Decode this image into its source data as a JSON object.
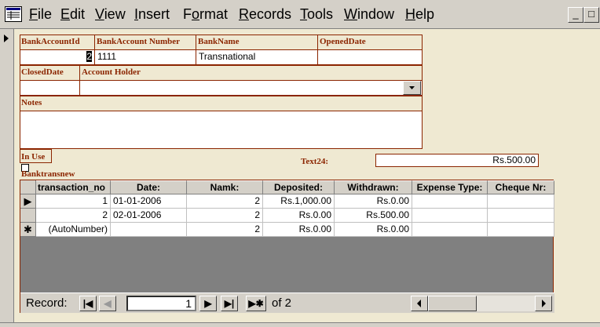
{
  "menu": {
    "items": [
      {
        "label": "File",
        "u": "F",
        "rest": "ile"
      },
      {
        "label": "Edit",
        "u": "E",
        "rest": "dit"
      },
      {
        "label": "View",
        "u": "V",
        "rest": "iew"
      },
      {
        "label": "Insert",
        "u": "I",
        "rest": "nsert"
      },
      {
        "label": "Format",
        "pre": "F",
        "u": "o",
        "rest": "rmat"
      },
      {
        "label": "Records",
        "u": "R",
        "rest": "ecords"
      },
      {
        "label": "Tools",
        "u": "T",
        "rest": "ools"
      },
      {
        "label": "Window",
        "u": "W",
        "rest": "indow"
      },
      {
        "label": "Help",
        "u": "H",
        "rest": "elp"
      }
    ],
    "minimize": "_",
    "restore": "□"
  },
  "form": {
    "bank_account_id_label": "BankAccountId",
    "bank_account_id": "2",
    "bank_account_number_label": "BankAccount Number",
    "bank_account_number": "1111",
    "bank_name_label": "BankName",
    "bank_name": "Transnational",
    "opened_date_label": "OpenedDate",
    "opened_date": "",
    "closed_date_label": "ClosedDate",
    "closed_date": "",
    "account_holder_label": "Account Holder",
    "account_holder": "",
    "notes_label": "Notes",
    "notes": "",
    "in_use_label": "In Use",
    "text24_label": "Text24:",
    "text24": "Rs.500.00",
    "subform_label": "Banktransnew"
  },
  "subform": {
    "columns": [
      "transaction_no",
      "Date:",
      "Namk:",
      "Deposited:",
      "Withdrawn:",
      "Expense Type:",
      "Cheque Nr:"
    ],
    "rows": [
      {
        "selector": "▶",
        "cells": [
          "1",
          "01-01-2006",
          "2",
          "Rs.1,000.00",
          "Rs.0.00",
          "",
          ""
        ]
      },
      {
        "selector": "",
        "cells": [
          "2",
          "02-01-2006",
          "2",
          "Rs.0.00",
          "Rs.500.00",
          "",
          ""
        ]
      },
      {
        "selector": "✱",
        "cells": [
          "(AutoNumber)",
          "",
          "2",
          "Rs.0.00",
          "Rs.0.00",
          "",
          ""
        ]
      }
    ],
    "nav": {
      "record_label": "Record:",
      "current": "1",
      "of_label": "of 2",
      "first": "|◀",
      "prev": "◀",
      "next": "▶",
      "last": "▶|",
      "new": "▶✱"
    }
  }
}
